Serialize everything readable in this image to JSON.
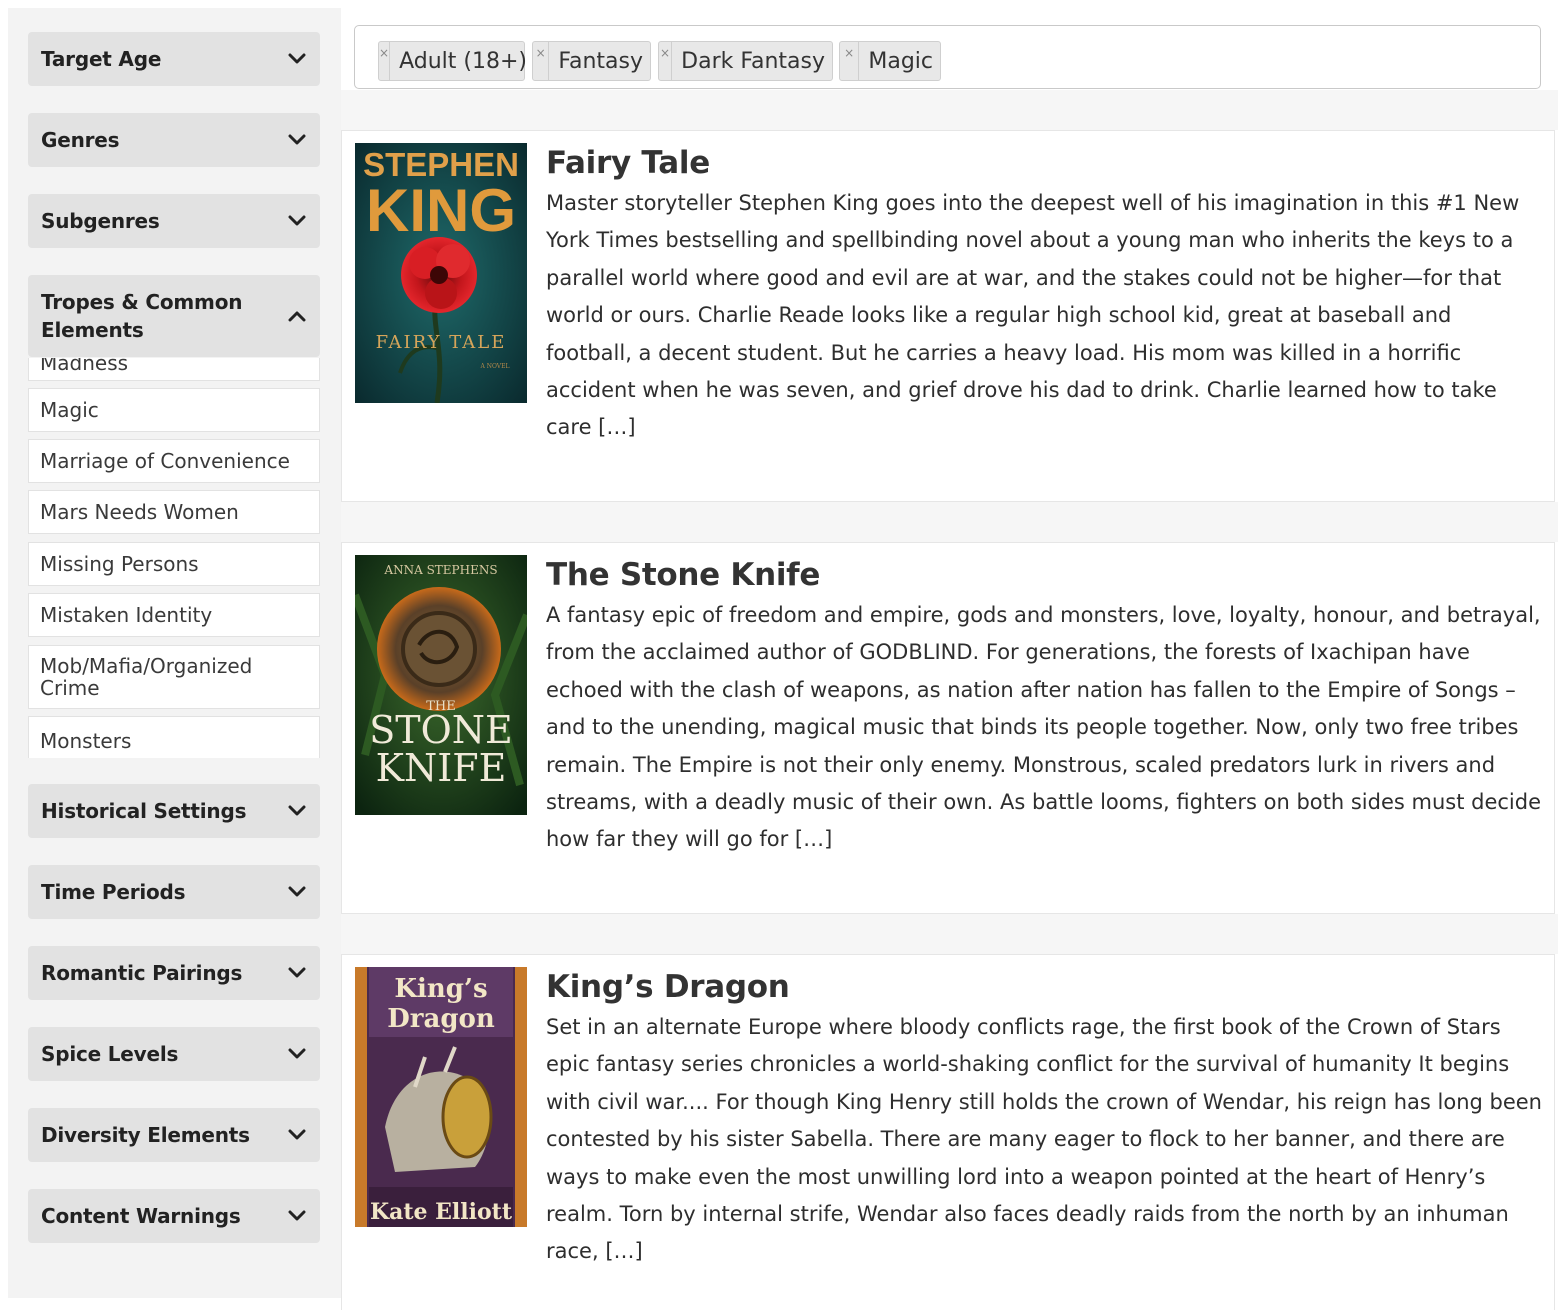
{
  "sidebar": {
    "sections": [
      {
        "label": "Target Age",
        "state": "collapsed"
      },
      {
        "label": "Genres",
        "state": "collapsed"
      },
      {
        "label": "Subgenres",
        "state": "collapsed"
      },
      {
        "label": "Tropes & Common Elements",
        "state": "expanded"
      },
      {
        "label": "Historical Settings",
        "state": "collapsed"
      },
      {
        "label": "Time Periods",
        "state": "collapsed"
      },
      {
        "label": "Romantic Pairings",
        "state": "collapsed"
      },
      {
        "label": "Spice Levels",
        "state": "collapsed"
      },
      {
        "label": "Diversity Elements",
        "state": "collapsed"
      },
      {
        "label": "Content Warnings",
        "state": "collapsed"
      }
    ],
    "trope_options": [
      "Madness",
      "Magic",
      "Marriage of Convenience",
      "Mars Needs Women",
      "Missing Persons",
      "Mistaken Identity",
      "Mob/Mafia/Organized Crime",
      "Monsters"
    ]
  },
  "filters": {
    "remove_symbol": "×",
    "chips": [
      "Adult (18+)",
      "Fantasy",
      "Dark Fantasy",
      "Magic"
    ]
  },
  "books": [
    {
      "title": "Fairy Tale",
      "description": "Master storyteller Stephen King goes into the deepest well of his imagination in this #1 New York Times bestselling and spellbinding novel about a young man who inherits the keys to a parallel world where good and evil are at war, and the stakes could not be higher—for that world or ours. Charlie Reade looks like a regular high school kid, great at baseball and football, a decent student. But he carries a heavy load. His mom was killed in a horrific accident when he was seven, and grief drove his dad to drink. Charlie learned how to take care […]",
      "cover": {
        "top_text": "STEPHEN",
        "main_text": "KING",
        "bottom_text": "FAIRY TALE",
        "small_text": "A NOVEL"
      }
    },
    {
      "title": "The Stone Knife",
      "description": "A fantasy epic of freedom and empire, gods and monsters, love, loyalty, honour, and betrayal, from the acclaimed author of GODBLIND. For generations, the forests of Ixachipan have echoed with the clash of weapons, as nation after nation has fallen to the Empire of Songs – and to the unending, magical music that binds its people together. Now, only two free tribes remain. The Empire is not their only enemy. Monstrous, scaled predators lurk in rivers and streams, with a deadly music of their own. As battle looms, fighters on both sides must decide how far they will go for […]",
      "cover": {
        "top_text": "ANNA STEPHENS",
        "main_text": "STONE",
        "main_text_2": "KNIFE",
        "small_text": "THE"
      }
    },
    {
      "title": "King’s Dragon",
      "description": "Set in an alternate Europe where bloody conflicts rage, the first book of the Crown of Stars epic fantasy series chronicles a world-shaking conflict for the survival of humanity It begins with civil war.... For though King Henry still holds the crown of Wendar, his reign has long been contested by his sister Sabella. There are many eager to flock to her banner, and there are ways to make even the most unwilling lord into a weapon pointed at the heart of Henry’s realm. Torn by internal strife, Wendar also faces deadly raids from the north by an inhuman race, […]",
      "cover": {
        "main_text": "King’s",
        "main_text_2": "Dragon",
        "bottom_text": "Kate Elliott"
      }
    }
  ],
  "colors": {
    "panel": "#f3f3f3",
    "accordion": "#e2e2e2",
    "chip": "#e8e8e8"
  }
}
